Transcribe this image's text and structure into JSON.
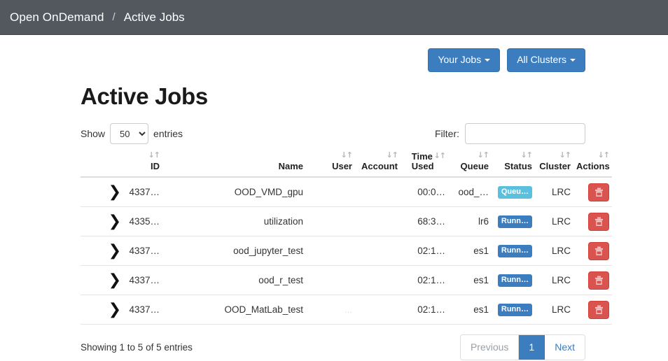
{
  "navbar": {
    "brand": "Open OnDemand",
    "separator": "/",
    "current": "Active Jobs"
  },
  "toolbar": {
    "your_jobs_label": "Your Jobs",
    "all_clusters_label": "All Clusters"
  },
  "page": {
    "title": "Active Jobs"
  },
  "controls": {
    "show_label": "Show",
    "entries_label": "entries",
    "page_length_value": "50",
    "page_length_options": [
      "50"
    ],
    "filter_label": "Filter:",
    "filter_value": "",
    "filter_placeholder": ""
  },
  "table": {
    "columns": [
      {
        "key": "expand",
        "label": "",
        "sortable": false
      },
      {
        "key": "id",
        "label": "ID",
        "sortable": true
      },
      {
        "key": "name",
        "label": "Name",
        "sortable": false
      },
      {
        "key": "user",
        "label": "User",
        "sortable": true
      },
      {
        "key": "account",
        "label": "Account",
        "sortable": true
      },
      {
        "key": "time",
        "label": "Time Used",
        "label_line1": "Time",
        "label_line2": "Used",
        "sortable": true
      },
      {
        "key": "queue",
        "label": "Queue",
        "sortable": true
      },
      {
        "key": "status",
        "label": "Status",
        "sortable": true
      },
      {
        "key": "cluster",
        "label": "Cluster",
        "sortable": true
      },
      {
        "key": "actions",
        "label": "Actions",
        "sortable": true
      }
    ],
    "sort_icon": "↓↑",
    "expand_icon": "❯",
    "rows": [
      {
        "id": "4337…",
        "name": "OOD_VMD_gpu",
        "user": "",
        "account": "",
        "time": "00:0…",
        "queue": "ood_…",
        "status": "Queu…",
        "status_type": "info",
        "cluster": "LRC",
        "action": "delete"
      },
      {
        "id": "4335…",
        "name": "utilization",
        "user": "",
        "account": "",
        "time": "68:3…",
        "queue": "lr6",
        "status": "Runn…",
        "status_type": "primary",
        "cluster": "LRC",
        "action": "delete"
      },
      {
        "id": "4337…",
        "name": "ood_jupyter_test",
        "user": "",
        "account": "",
        "time": "02:1…",
        "queue": "es1",
        "status": "Runn…",
        "status_type": "primary",
        "cluster": "LRC",
        "action": "delete"
      },
      {
        "id": "4337…",
        "name": "ood_r_test",
        "user": "",
        "account": "",
        "time": "02:1…",
        "queue": "es1",
        "status": "Runn…",
        "status_type": "primary",
        "cluster": "LRC",
        "action": "delete"
      },
      {
        "id": "4337…",
        "name": "OOD_MatLab_test",
        "user": "…",
        "account": "",
        "time": "02:1…",
        "queue": "es1",
        "status": "Runn…",
        "status_type": "primary",
        "cluster": "LRC",
        "action": "delete"
      }
    ]
  },
  "footer": {
    "info": "Showing 1 to 5 of 5 entries",
    "previous_label": "Previous",
    "page_1_label": "1",
    "next_label": "Next"
  },
  "colors": {
    "navbar_bg": "#53585f",
    "primary": "#3b7dbf",
    "info": "#5bc0de",
    "danger": "#d9534f"
  }
}
